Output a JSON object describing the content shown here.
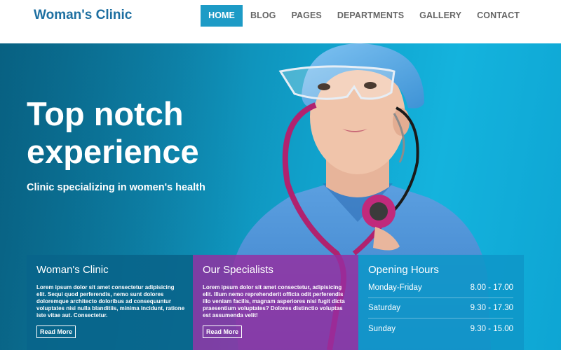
{
  "header": {
    "logo": "Woman's Clinic",
    "nav": [
      {
        "label": "HOME",
        "active": true
      },
      {
        "label": "BLOG",
        "active": false
      },
      {
        "label": "PAGES",
        "active": false
      },
      {
        "label": "DEPARTMENTS",
        "active": false
      },
      {
        "label": "GALLERY",
        "active": false
      },
      {
        "label": "CONTACT",
        "active": false
      }
    ]
  },
  "hero": {
    "title": "Top notch experience",
    "subtitle": "Clinic specializing in women's health"
  },
  "panels": {
    "about": {
      "title": "Woman's Clinic",
      "text": "Lorem ipsum dolor sit amet consectetur adipisicing elit. Sequi quod perferendis, nemo sunt dolores doloremque architecto doloribus ad consequuntur voluptates nisi nulla blanditiis, minima incidunt, ratione iste vitae aut. Consectetur.",
      "button": "Read More"
    },
    "specialists": {
      "title": "Our Specialists",
      "text": "Lorem ipsum dolor sit amet consectetur, adipisicing elit. Illum nemo reprehenderit officia odit perferendis illo veniam facilis, magnam asperiores nisi fugit dicta praesentium voluptates? Dolores distinctio voluptas est assumenda velit!",
      "button": "Read More"
    },
    "hours": {
      "title": "Opening Hours",
      "rows": [
        {
          "day": "Monday-Friday",
          "time": "8.00 - 17.00"
        },
        {
          "day": "Saturday",
          "time": "9.30 - 17.30"
        },
        {
          "day": "Sunday",
          "time": "9.30 - 15.00"
        }
      ]
    }
  },
  "colors": {
    "brand": "#1d6fa1",
    "nav_active": "#1d9bc6",
    "hero_blue": "#10a2cc",
    "panel_dark_blue": "#09658b",
    "panel_purple": "#962da0",
    "panel_light_blue": "#0e96c8"
  }
}
